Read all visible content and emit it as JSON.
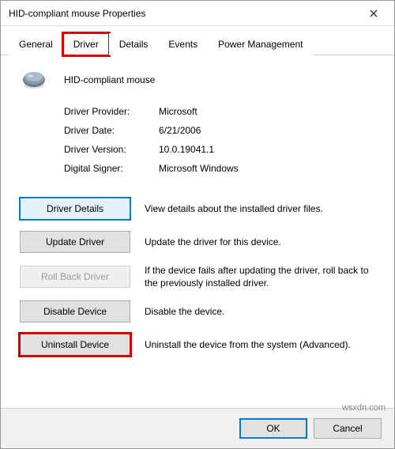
{
  "window": {
    "title": "HID-compliant mouse Properties"
  },
  "tabs": {
    "general": "General",
    "driver": "Driver",
    "details": "Details",
    "events": "Events",
    "power": "Power Management"
  },
  "device": {
    "name": "HID-compliant mouse"
  },
  "props": {
    "provider_lbl": "Driver Provider:",
    "provider_val": "Microsoft",
    "date_lbl": "Driver Date:",
    "date_val": "6/21/2006",
    "version_lbl": "Driver Version:",
    "version_val": "10.0.19041.1",
    "signer_lbl": "Digital Signer:",
    "signer_val": "Microsoft Windows"
  },
  "actions": {
    "details_btn": "Driver Details",
    "details_desc": "View details about the installed driver files.",
    "update_btn": "Update Driver",
    "update_desc": "Update the driver for this device.",
    "rollback_btn": "Roll Back Driver",
    "rollback_desc": "If the device fails after updating the driver, roll back to the previously installed driver.",
    "disable_btn": "Disable Device",
    "disable_desc": "Disable the device.",
    "uninstall_btn": "Uninstall Device",
    "uninstall_desc": "Uninstall the device from the system (Advanced)."
  },
  "footer": {
    "ok": "OK",
    "cancel": "Cancel"
  },
  "watermark": "wsxdn.com"
}
